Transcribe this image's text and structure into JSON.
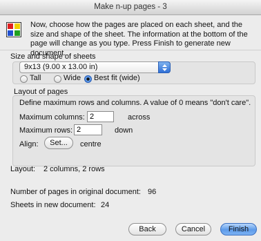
{
  "window": {
    "title": "Make n-up pages - 3"
  },
  "intro": {
    "text": "Now, choose how the pages are placed on each sheet, and the size and shape of the sheet. The information at the bottom of the page will change as you type. Press Finish to generate new document."
  },
  "size_group": {
    "label": "Size and shape of sheets",
    "select_value": "9x13 (9.00 x 13.00 in)",
    "options": [
      "Tall",
      "Wide",
      "Best fit (wide)"
    ],
    "selected": "Best fit (wide)"
  },
  "layout_group": {
    "label": "Layout of pages",
    "hint": "Define maximum rows and columns. A value of 0 means \"don't care\".",
    "max_columns_label": "Maximum columns:",
    "max_columns_value": "2",
    "across": "across",
    "max_rows_label": "Maximum rows:",
    "max_rows_value": "2",
    "down": "down",
    "align_label": "Align:",
    "set_button": "Set...",
    "align_value": "centre"
  },
  "info": {
    "layout_label": "Layout:",
    "layout_value": "2 columns, 2 rows",
    "pages_label": "Number of pages in original document:",
    "pages_value": "96",
    "sheets_label": "Sheets in new document:",
    "sheets_value": "24"
  },
  "buttons": {
    "back": "Back",
    "cancel": "Cancel",
    "finish": "Finish"
  },
  "colors": {
    "accent": "#2f6fd6",
    "default_button": "#5d9be9"
  }
}
